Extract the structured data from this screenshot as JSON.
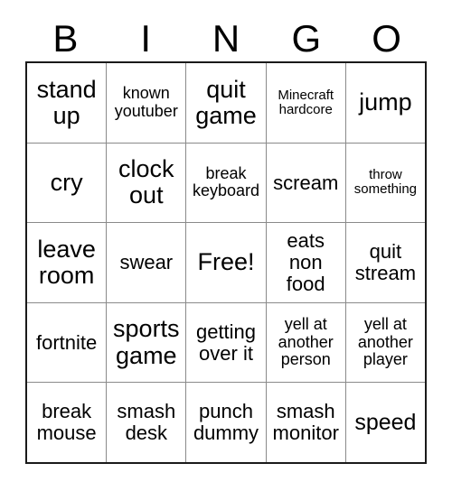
{
  "card": {
    "title": "BINGO",
    "header_letters": [
      "B",
      "I",
      "N",
      "G",
      "O"
    ],
    "free_space_label": "Free!",
    "colors": {
      "background": "#ffffff",
      "cell_background": "#ffffff",
      "text": "#000000",
      "outer_border": "#1a1a1a",
      "inner_grid_line": "#8a8a8a"
    },
    "rows": [
      [
        {
          "text": "stand up",
          "size": "s-xl"
        },
        {
          "text": "known youtuber",
          "size": "s-sm"
        },
        {
          "text": "quit game",
          "size": "s-xl"
        },
        {
          "text": "Minecraft hardcore",
          "size": "s-xs"
        },
        {
          "text": "jump",
          "size": "s-xl"
        }
      ],
      [
        {
          "text": "cry",
          "size": "s-xl"
        },
        {
          "text": "clock out",
          "size": "s-xl"
        },
        {
          "text": "break keyboard",
          "size": "s-sm"
        },
        {
          "text": "scream",
          "size": "s-md"
        },
        {
          "text": "throw something",
          "size": "s-xs"
        }
      ],
      [
        {
          "text": "leave room",
          "size": "s-xl"
        },
        {
          "text": "swear",
          "size": "s-md"
        },
        {
          "text": "Free!",
          "size": "s-xl"
        },
        {
          "text": "eats non food",
          "size": "s-md"
        },
        {
          "text": "quit stream",
          "size": "s-md"
        }
      ],
      [
        {
          "text": "fortnite",
          "size": "s-md"
        },
        {
          "text": "sports game",
          "size": "s-xl"
        },
        {
          "text": "getting over it",
          "size": "s-md"
        },
        {
          "text": "yell at another person",
          "size": "s-sm"
        },
        {
          "text": "yell at another player",
          "size": "s-sm"
        }
      ],
      [
        {
          "text": "break mouse",
          "size": "s-md"
        },
        {
          "text": "smash desk",
          "size": "s-md"
        },
        {
          "text": "punch dummy",
          "size": "s-md"
        },
        {
          "text": "smash monitor",
          "size": "s-md"
        },
        {
          "text": "speed",
          "size": "s-lg"
        }
      ]
    ]
  }
}
